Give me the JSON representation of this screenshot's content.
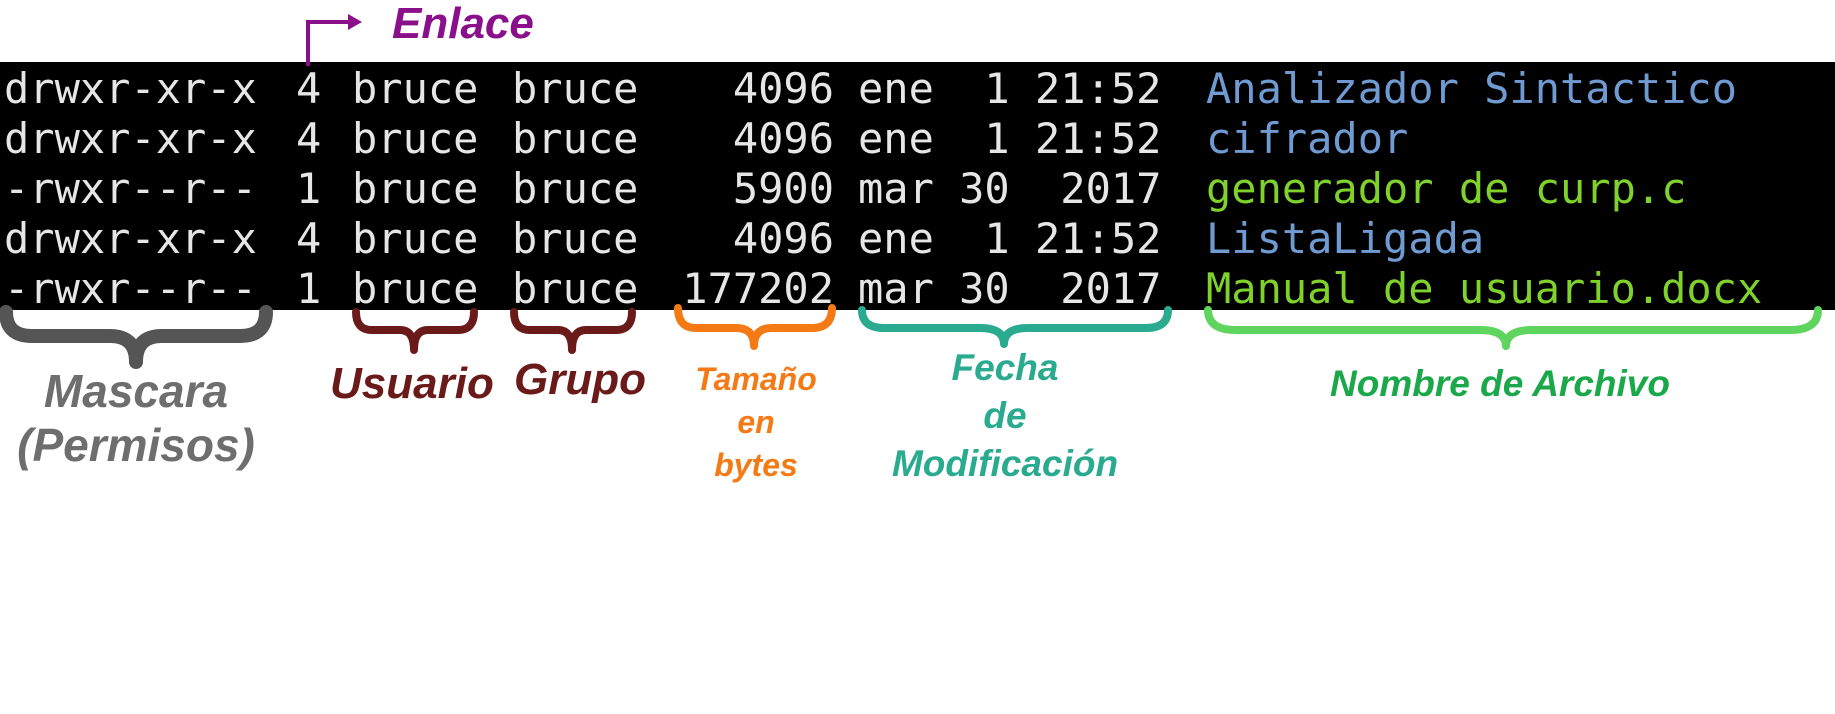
{
  "listing": [
    {
      "perm": "drwxr-xr-x",
      "links": "4",
      "user": "bruce",
      "group": "bruce",
      "size": "4096",
      "date": "ene  1 21:52",
      "name": "Analizador Sintactico",
      "kind": "dir"
    },
    {
      "perm": "drwxr-xr-x",
      "links": "4",
      "user": "bruce",
      "group": "bruce",
      "size": "4096",
      "date": "ene  1 21:52",
      "name": "cifrador",
      "kind": "dir"
    },
    {
      "perm": "-rwxr--r--",
      "links": "1",
      "user": "bruce",
      "group": "bruce",
      "size": "5900",
      "date": "mar 30  2017",
      "name": "generador de curp.c",
      "kind": "file"
    },
    {
      "perm": "drwxr-xr-x",
      "links": "4",
      "user": "bruce",
      "group": "bruce",
      "size": "4096",
      "date": "ene  1 21:52",
      "name": "ListaLigada",
      "kind": "dir"
    },
    {
      "perm": "-rwxr--r--",
      "links": "1",
      "user": "bruce",
      "group": "bruce",
      "size": "177202",
      "date": "mar 30  2017",
      "name": "Manual de usuario.docx",
      "kind": "file"
    }
  ],
  "labels": {
    "enlace": "Enlace",
    "mascara": [
      "Mascara",
      "(Permisos)"
    ],
    "usuario": "Usuario",
    "grupo": "Grupo",
    "tamano": [
      "Tamaño",
      "en",
      "bytes"
    ],
    "fecha": [
      "Fecha",
      "de",
      "Modificación"
    ],
    "nombre": "Nombre de Archivo"
  },
  "colors": {
    "terminal_bg": "#000000",
    "terminal_text": "#e6e6e6",
    "directory": "#6f9bd2",
    "file": "#7fd12c",
    "enlace": "#8a0f8a",
    "mascara": "#6e6e6e",
    "usuario": "#6b1a1a",
    "grupo": "#6b1a1a",
    "tamano": "#f47a15",
    "fecha": "#2aaa8e",
    "nombre": "#1ba84a"
  }
}
